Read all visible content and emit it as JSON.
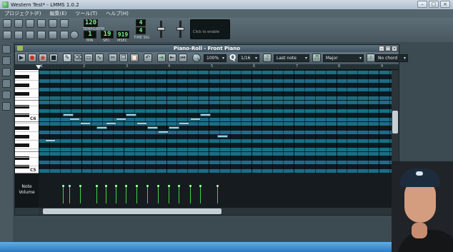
{
  "window": {
    "title": "Western Test* - LMMS 1.0.2",
    "controls": [
      "–",
      "□",
      "×"
    ]
  },
  "menu": [
    "プロジェクト(F)",
    "編集(E)",
    "ツール(T)",
    "ヘルプ(H)"
  ],
  "toolbar": {
    "tempo_value": "120",
    "tempo_label": "TEMPO/BPM",
    "time_min": "1",
    "time_sec": "19",
    "time_msec": "919",
    "time_label_min": "MIN",
    "time_label_sec": "SEC",
    "time_label_msec": "MSEC",
    "time_sig_top": "4",
    "time_sig_bottom": "4",
    "time_sig_label": "TIME SIG",
    "oscilloscope_hint": "Click to enable"
  },
  "piano_roll": {
    "title": "Piano-Roll - Front Piano",
    "zoom": "100%",
    "quantize": "1/16",
    "note_length": "Last note",
    "scale": "Major",
    "chord": "No chord",
    "octave_labels": [
      "C6",
      "C5"
    ],
    "timeline_numbers": [
      "1",
      "2",
      "3",
      "4",
      "5",
      "6",
      "7",
      "8",
      "9"
    ],
    "volume_label_line1": "Note",
    "volume_label_line2": "Volume"
  },
  "notes": [
    {
      "row": 10,
      "start": 0.57
    },
    {
      "row": 11,
      "start": 0.73
    },
    {
      "row": 12,
      "start": 0.97
    },
    {
      "row": 13,
      "start": 1.36
    },
    {
      "row": 12,
      "start": 1.58
    },
    {
      "row": 11,
      "start": 1.82
    },
    {
      "row": 10,
      "start": 2.05
    },
    {
      "row": 12,
      "start": 2.3
    },
    {
      "row": 13,
      "start": 2.55
    },
    {
      "row": 14,
      "start": 2.8
    },
    {
      "row": 13,
      "start": 3.06
    },
    {
      "row": 12,
      "start": 3.3
    },
    {
      "row": 11,
      "start": 3.56
    },
    {
      "row": 10,
      "start": 3.8
    },
    {
      "row": 15,
      "start": 4.2
    },
    {
      "row": 16,
      "start": 0.15
    }
  ],
  "note_volumes": [
    0.62,
    0.62,
    0.62,
    0.62,
    0.62,
    0.62,
    0.62,
    0.62,
    0.62,
    0.62,
    0.62,
    0.62,
    0.62,
    0.62,
    0.62
  ]
}
